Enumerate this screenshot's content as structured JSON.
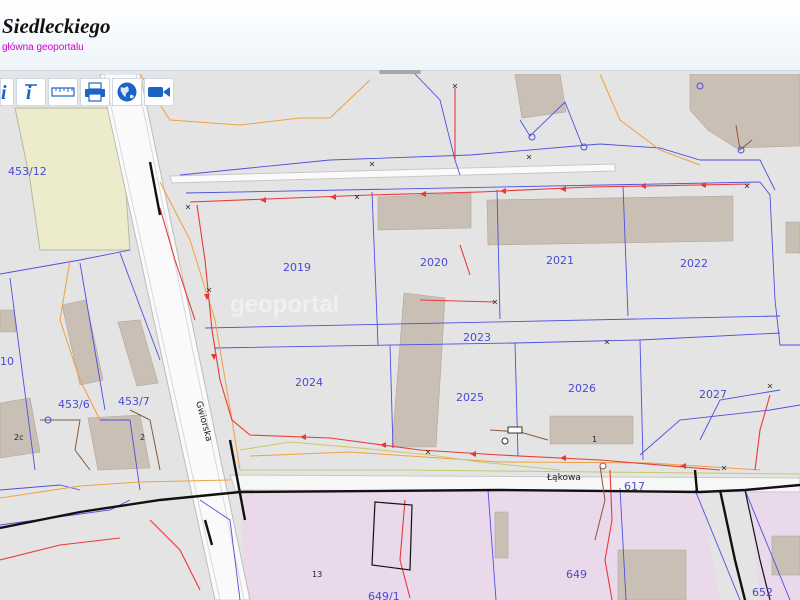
{
  "header": {
    "title": "Siedleckiego",
    "home_link": "główna geoportalu"
  },
  "toolbar": {
    "tools": [
      {
        "icon": "info-icon"
      },
      {
        "icon": "identify-icon"
      },
      {
        "icon": "measure-icon"
      },
      {
        "icon": "print-icon"
      },
      {
        "icon": "globe-icon"
      },
      {
        "icon": "video-camera-icon"
      }
    ]
  },
  "map": {
    "watermark": "geoportal",
    "parcels": {
      "p453_12": "453/12",
      "p10": "10",
      "p453_6": "453/6",
      "p453_7": "453/7",
      "p2c": "2c",
      "p2": "2",
      "p2019": "2019",
      "p2020": "2020",
      "p2021": "2021",
      "p2022": "2022",
      "p2023": "2023",
      "p2024": "2024",
      "p2025": "2025",
      "p2026": "2026",
      "p2027": "2027",
      "p1": "1",
      "p617": "617",
      "p13": "13",
      "p649": "649",
      "p649_1": "649/1",
      "p652": "652"
    },
    "streets": {
      "vertical": "Gwiorska",
      "horizontal": "Łąkowa"
    },
    "colors": {
      "parcel_line": "#4f4fe0",
      "network_red": "#e83a3a",
      "network_orange": "#f0a040",
      "building": "#c9bfb5",
      "zone_fill": "#ead9ea",
      "road_fill": "#fafafa",
      "yard_fill": "#ececcc"
    }
  }
}
